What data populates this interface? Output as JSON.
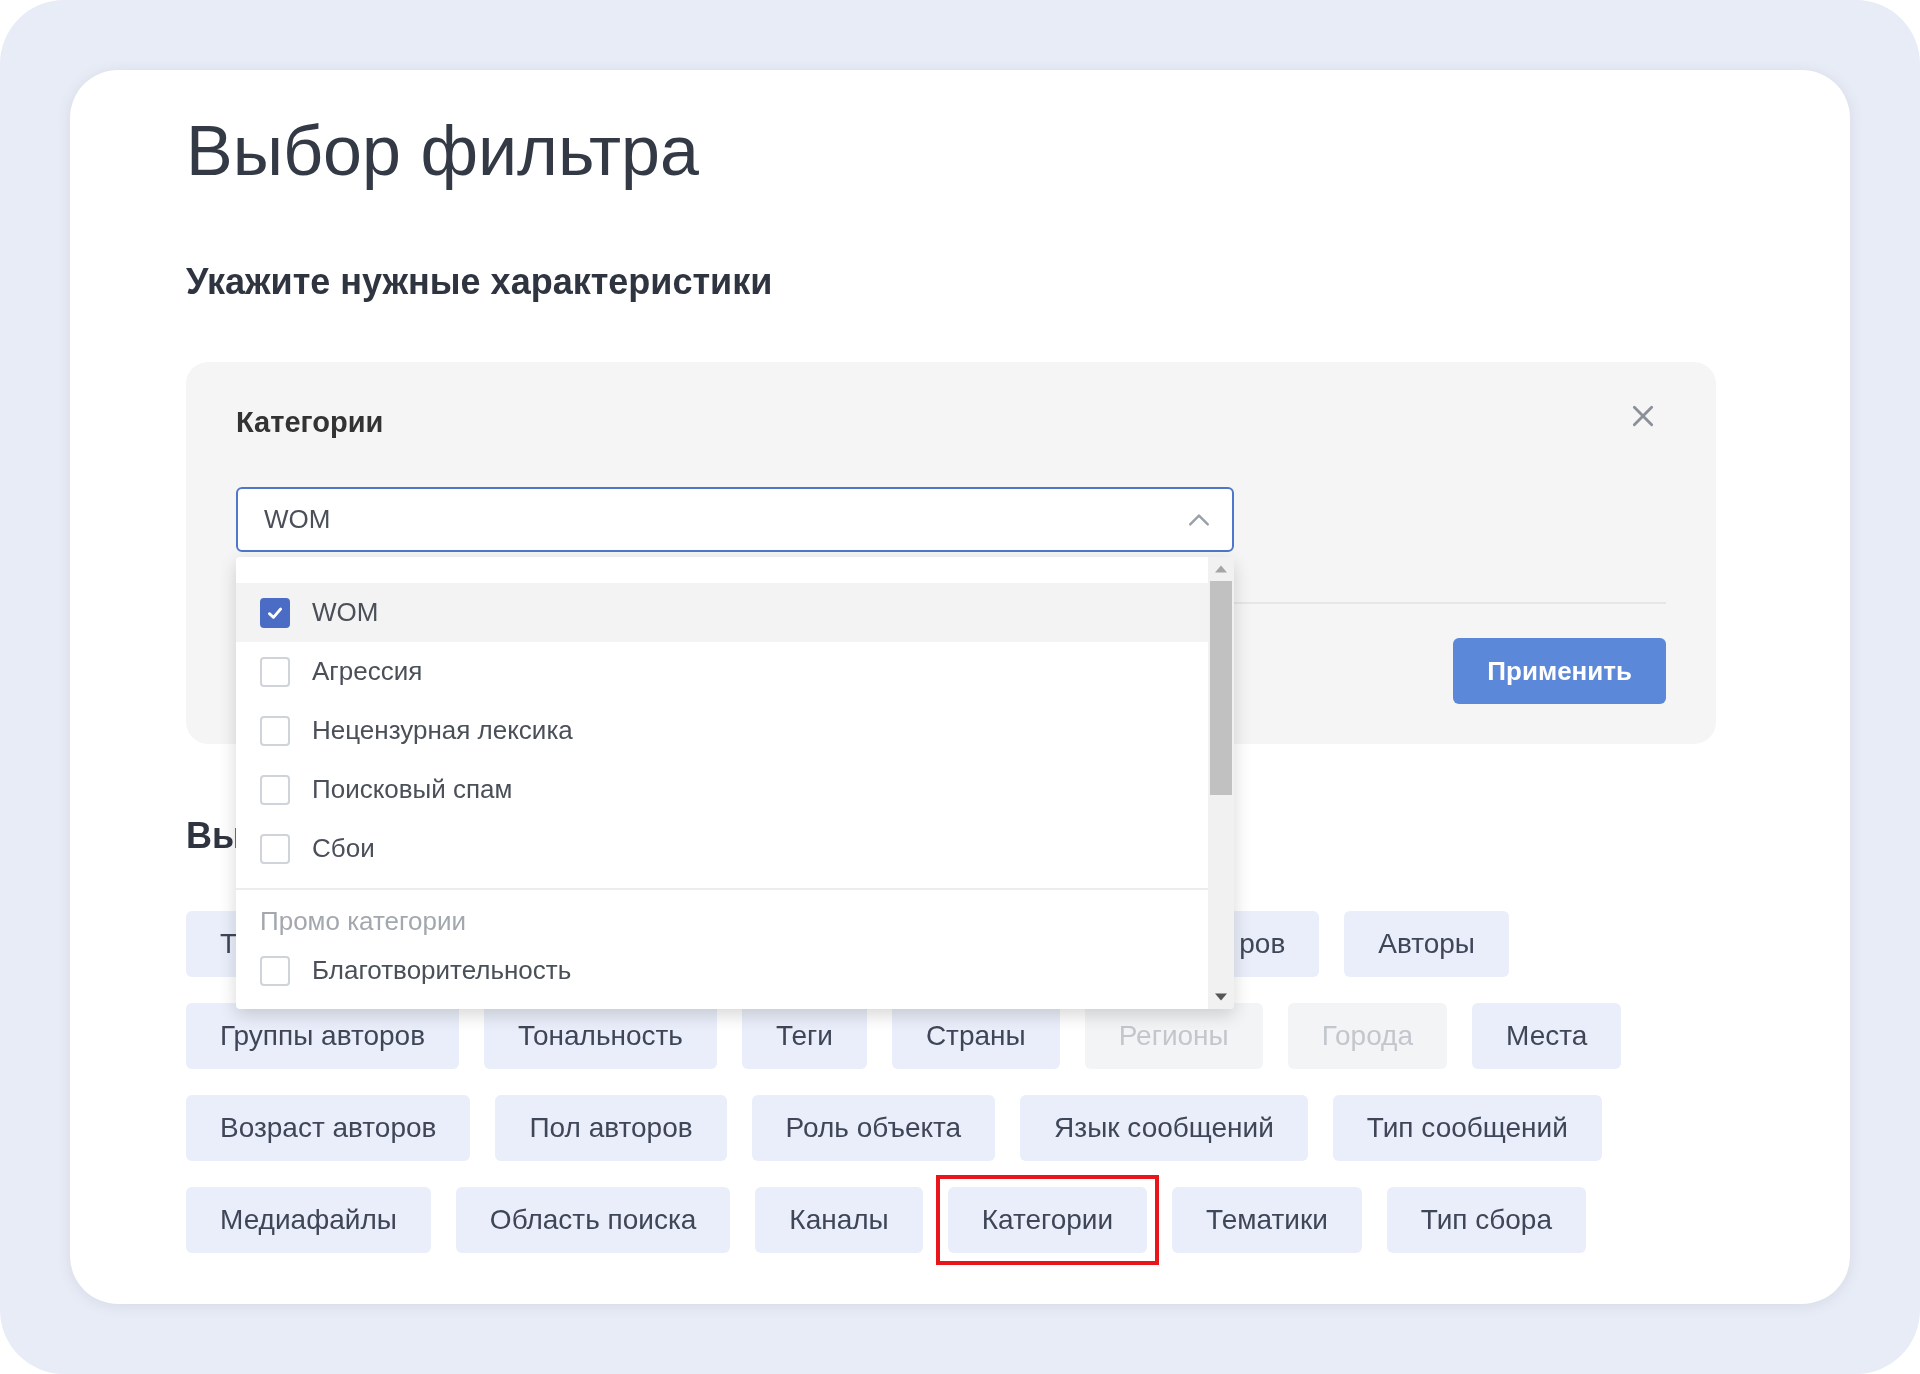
{
  "title": "Выбор фильтра",
  "subtitle": "Укажите нужные характеристики",
  "filter_panel": {
    "label": "Категории",
    "select": {
      "value": "WOM",
      "expanded": true
    },
    "apply_button": "Применить",
    "dropdown": {
      "items": [
        {
          "kind": "option",
          "label": "WOM",
          "checked": true,
          "hovered": true
        },
        {
          "kind": "option",
          "label": "Агрессия",
          "checked": false,
          "hovered": false
        },
        {
          "kind": "option",
          "label": "Нецензурная лексика",
          "checked": false,
          "hovered": false
        },
        {
          "kind": "option",
          "label": "Поисковый спам",
          "checked": false,
          "hovered": false
        },
        {
          "kind": "option",
          "label": "Сбои",
          "checked": false,
          "hovered": false
        },
        {
          "kind": "group",
          "label": "Промо категории"
        },
        {
          "kind": "option",
          "label": "Благотворительность",
          "checked": false,
          "hovered": false
        }
      ]
    }
  },
  "section_heading": "Вы",
  "tag_rows": [
    [
      {
        "label": "Т",
        "disabled": false,
        "highlighted": false,
        "kind": "cut-right"
      },
      {
        "label": "ров",
        "disabled": false,
        "highlighted": false,
        "kind": "cut-left"
      },
      {
        "label": "Авторы",
        "disabled": false,
        "highlighted": false,
        "kind": "tag"
      }
    ],
    [
      {
        "label": "Группы авторов",
        "disabled": false,
        "highlighted": false,
        "kind": "tag"
      },
      {
        "label": "Тональность",
        "disabled": false,
        "highlighted": false,
        "kind": "tag"
      },
      {
        "label": "Теги",
        "disabled": false,
        "highlighted": false,
        "kind": "tag"
      },
      {
        "label": "Страны",
        "disabled": false,
        "highlighted": false,
        "kind": "tag"
      },
      {
        "label": "Регионы",
        "disabled": true,
        "highlighted": false,
        "kind": "tag"
      },
      {
        "label": "Города",
        "disabled": true,
        "highlighted": false,
        "kind": "tag"
      },
      {
        "label": "Места",
        "disabled": false,
        "highlighted": false,
        "kind": "tag"
      }
    ],
    [
      {
        "label": "Возраст авторов",
        "disabled": false,
        "highlighted": false,
        "kind": "tag"
      },
      {
        "label": "Пол авторов",
        "disabled": false,
        "highlighted": false,
        "kind": "tag"
      },
      {
        "label": "Роль объекта",
        "disabled": false,
        "highlighted": false,
        "kind": "tag"
      },
      {
        "label": "Язык сообщений",
        "disabled": false,
        "highlighted": false,
        "kind": "tag"
      },
      {
        "label": "Тип сообщений",
        "disabled": false,
        "highlighted": false,
        "kind": "tag"
      }
    ],
    [
      {
        "label": "Медиафайлы",
        "disabled": false,
        "highlighted": false,
        "kind": "tag"
      },
      {
        "label": "Область поиска",
        "disabled": false,
        "highlighted": false,
        "kind": "tag"
      },
      {
        "label": "Каналы",
        "disabled": false,
        "highlighted": false,
        "kind": "tag"
      },
      {
        "label": "Категории",
        "disabled": false,
        "highlighted": true,
        "kind": "tag"
      },
      {
        "label": "Тематики",
        "disabled": false,
        "highlighted": false,
        "kind": "tag"
      },
      {
        "label": "Тип сбора",
        "disabled": false,
        "highlighted": false,
        "kind": "tag"
      }
    ]
  ]
}
